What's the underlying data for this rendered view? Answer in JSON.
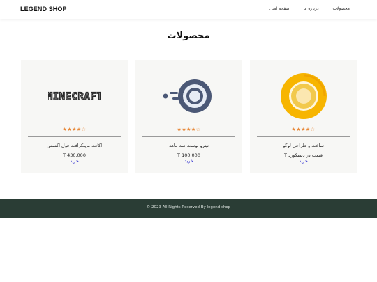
{
  "header": {
    "brand": "LEGEND SHOP",
    "nav": [
      "محصولات",
      "درباره ما",
      "صفحه اصل"
    ]
  },
  "main": {
    "title": "محصولات",
    "products": [
      {
        "name": "ساخت و طراحی لوگو",
        "price": "قیمت در دیسکورد T",
        "rating": "★★★★☆",
        "buy": "خرید",
        "image_icon": "android-oreo-logo-icon"
      },
      {
        "name": "نیترو بوست سه ماهه",
        "price": "100.000 T",
        "rating": "★★★★☆",
        "buy": "خرید",
        "image_icon": "discord-nitro-logo-icon"
      },
      {
        "name": "اکانت ماینکرافت فول اکسس",
        "price": "430.000 T",
        "rating": "★★★★☆",
        "buy": "خرید",
        "image_icon": "minecraft-logo-icon"
      }
    ]
  },
  "footer": {
    "text": "© 2023 All Rights Reserved By legend shop"
  },
  "colors": {
    "footer_bg": "#2a3d35",
    "buy_link": "#2b2bcf",
    "star": "#e8893a",
    "card_bg": "#f7f7f5"
  }
}
